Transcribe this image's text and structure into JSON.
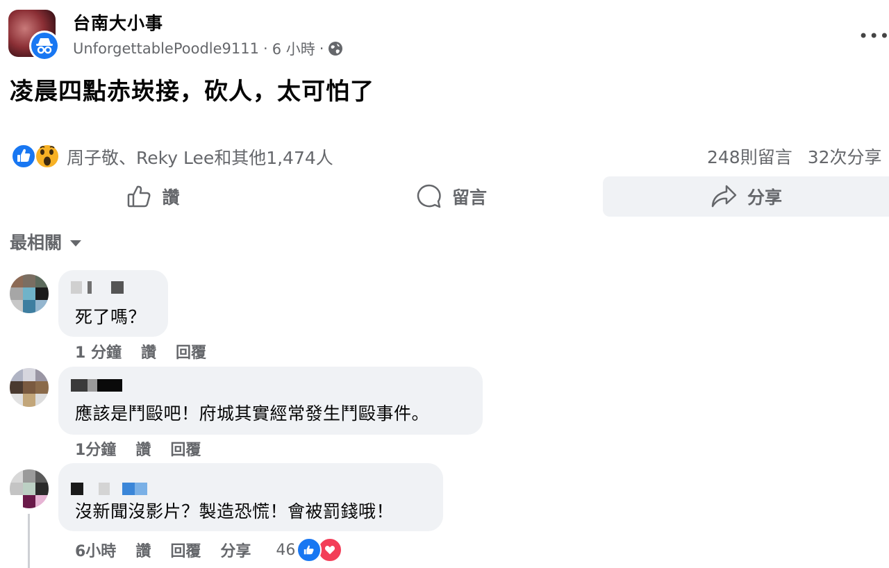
{
  "post": {
    "group_name": "台南大小事",
    "author": "UnforgettablePoodle9111",
    "separator": "·",
    "time": "6 小時",
    "text": "凌晨四點赤崁接，砍人，太可怕了"
  },
  "reactions": {
    "names": "周子敬、Reky Lee和其他1,474人",
    "comments_count": "248則留言",
    "shares_count": "32次分享"
  },
  "actions": {
    "like": "讚",
    "comment": "留言",
    "share": "分享"
  },
  "sort_label": "最相關",
  "comments": [
    {
      "text": "死了嗎？",
      "time": "1 分鐘",
      "like": "讚",
      "reply": "回覆"
    },
    {
      "text": "應該是鬥毆吧！府城其實經常發生鬥毆事件。",
      "time": "1分鐘",
      "like": "讚",
      "reply": "回覆"
    },
    {
      "text": "沒新聞沒影片？製造恐慌！會被罰錢哦！",
      "time": "6小時",
      "like": "讚",
      "reply": "回覆",
      "share": "分享",
      "reaction_count": "46"
    }
  ],
  "colors": {
    "accent": "#1877f2",
    "secondary_text": "#65676b",
    "bubble_bg": "#f0f2f5",
    "love": "#f33e58",
    "wow": "#f7b125"
  },
  "icons": [
    "more-icon",
    "globe-icon",
    "like-icon",
    "wow-icon",
    "thumb-icon",
    "comment-icon",
    "share-icon",
    "caret-icon",
    "love-icon"
  ]
}
